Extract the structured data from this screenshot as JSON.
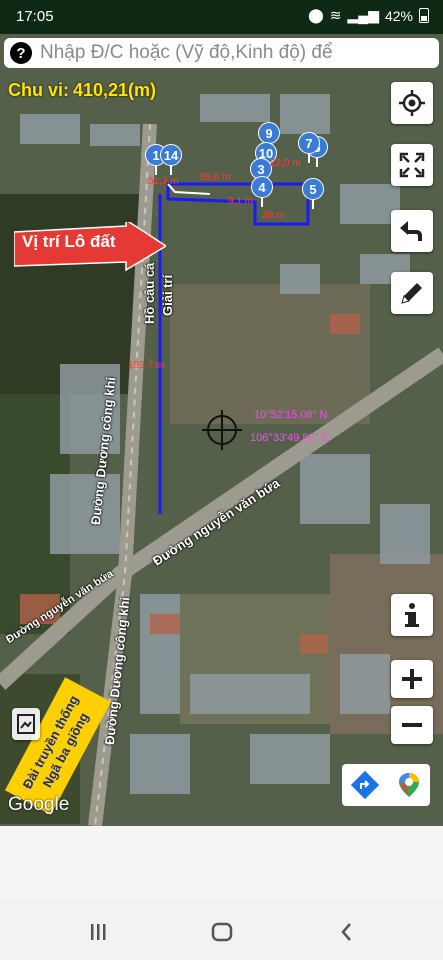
{
  "status": {
    "time": "17:05",
    "battery": "42%"
  },
  "search": {
    "placeholder": "Nhập Đ/C hoặc (Vỹ độ,Kinh độ) để"
  },
  "perimeter": {
    "label": "Chu vi:",
    "value": "410,21(m)"
  },
  "annotation": {
    "plot_label": "Vị trí Lô đất"
  },
  "map_labels": {
    "pond": "Hồ câu cá",
    "pond2": "Giải trí",
    "road_cong_khi": "Đường Dương công khi",
    "road_cong_khi_2": "Đường Dương công khi",
    "road_nguyen_van_bua": "Đường nguyễn văn bứa",
    "road_nguyen_van_bua_2": "Đường nguyễn văn bứa"
  },
  "measurements": {
    "m1": "52,3 m",
    "m2": "55,6 m",
    "m3": "30 m",
    "m4": "22,0 m",
    "m5": "193,7 m",
    "m6": "9,1 m"
  },
  "pins": [
    "1",
    "14",
    "9",
    "10",
    "3",
    "4",
    "5",
    "6",
    "7"
  ],
  "coordinates": {
    "lat": "10°52'15.08\" N",
    "lng": "106°33'49.88\" E"
  },
  "sign": {
    "line1": "Đài truyền thống",
    "line2": "Ngã ba giồng"
  },
  "watermark": "Google",
  "colors": {
    "accent": "#ffe600",
    "route": "#1a1aff",
    "pin": "#3a7bd5",
    "arrow": "#e53935"
  }
}
